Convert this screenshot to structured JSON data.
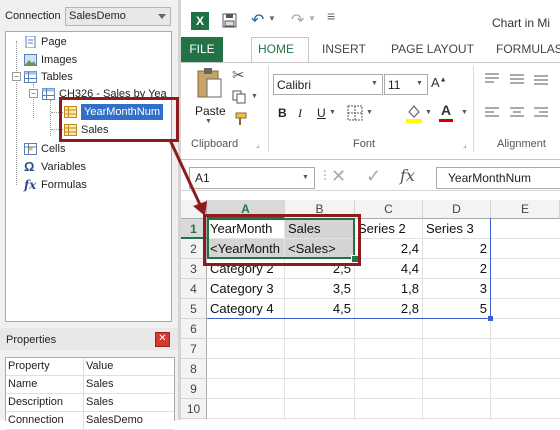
{
  "connection": {
    "label": "Connection",
    "value": "SalesDemo"
  },
  "tree": {
    "page": "Page",
    "images": "Images",
    "tables": "Tables",
    "table_name": "CH326 - Sales by Yea",
    "field_yearmonth": "YearMonthNum",
    "field_sales": "Sales",
    "cells": "Cells",
    "variables": "Variables",
    "formulas": "Formulas"
  },
  "properties": {
    "title": "Properties",
    "col_property": "Property",
    "col_value": "Value",
    "rows": [
      {
        "name": "Name",
        "value": "Sales"
      },
      {
        "name": "Description",
        "value": "Sales"
      },
      {
        "name": "Connection",
        "value": "SalesDemo"
      }
    ]
  },
  "excel": {
    "title": "Chart in Mi",
    "tabs": [
      "FILE",
      "HOME",
      "INSERT",
      "PAGE LAYOUT",
      "FORMULAS"
    ],
    "clipboard": {
      "paste": "Paste",
      "group": "Clipboard"
    },
    "font": {
      "name": "Calibri",
      "size": "11",
      "group": "Font",
      "bold": "B",
      "italic": "I",
      "underline": "U",
      "fontcolor": "A"
    },
    "alignment_group": "Alignment",
    "namebox": "A1",
    "fx": "fx",
    "formula": "YearMonthNum",
    "columns": [
      "A",
      "B",
      "C",
      "D",
      "E"
    ],
    "rows": [
      "1",
      "2",
      "3",
      "4",
      "5",
      "6",
      "7",
      "8",
      "9",
      "10"
    ],
    "cells": {
      "r1": [
        "YearMonth",
        "Sales",
        "Series 2",
        "Series 3"
      ],
      "r2": [
        "<YearMonth",
        "<Sales>",
        "2,4",
        "2"
      ],
      "r3": [
        "Category 2",
        "2,5",
        "4,4",
        "2"
      ],
      "r4": [
        "Category 3",
        "3,5",
        "1,8",
        "3"
      ],
      "r5": [
        "Category 4",
        "4,5",
        "2,8",
        "5"
      ]
    }
  },
  "colors": {
    "excel_green": "#217346",
    "highlight_red": "#8e1c1c",
    "selection_blue": "#3170c6"
  }
}
